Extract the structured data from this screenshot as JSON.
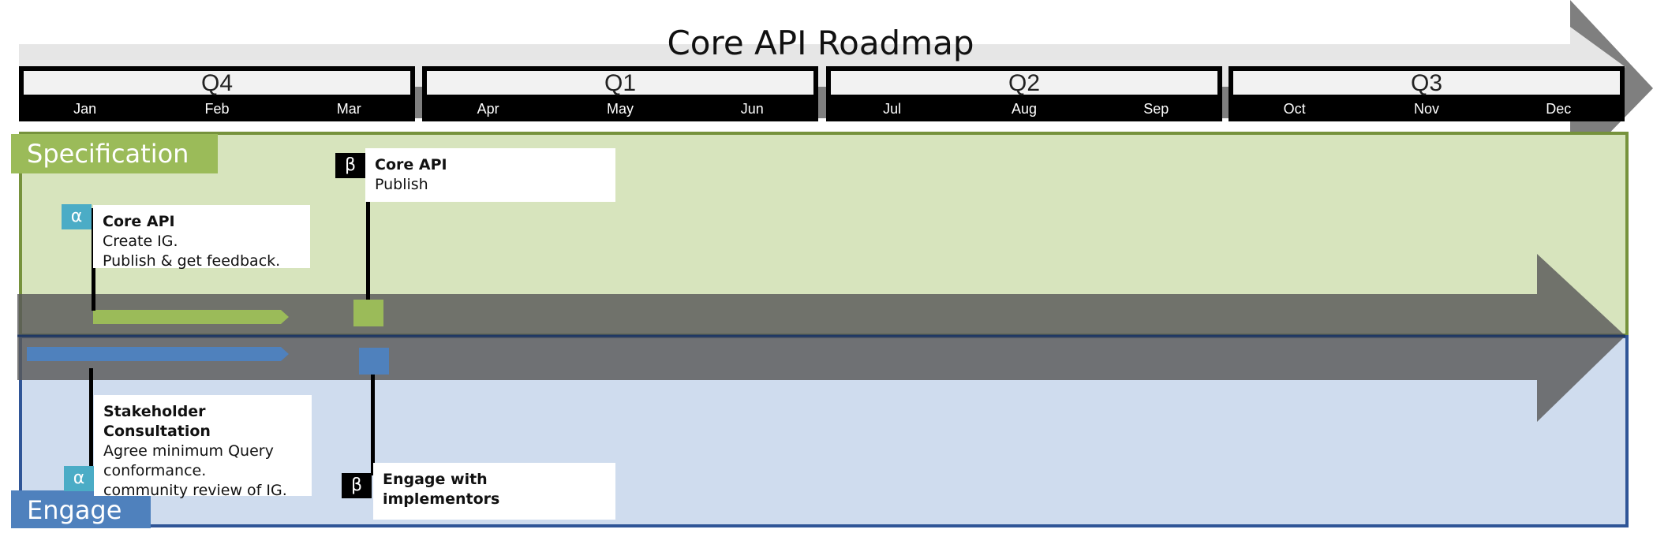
{
  "title": "Core API Roadmap",
  "quarters": [
    {
      "label": "Q4",
      "months": [
        "Jan",
        "Feb",
        "Mar"
      ]
    },
    {
      "label": "Q1",
      "months": [
        "Apr",
        "May",
        "Jun"
      ]
    },
    {
      "label": "Q2",
      "months": [
        "Jul",
        "Aug",
        "Sep"
      ]
    },
    {
      "label": "Q3",
      "months": [
        "Oct",
        "Nov",
        "Dec"
      ]
    }
  ],
  "lanes": {
    "specification": {
      "label": "Specification",
      "color": "#9bbb59",
      "bg": "#d7e4bd"
    },
    "engage": {
      "label": "Engage",
      "color": "#4f81bd",
      "bg": "#cfdcee"
    }
  },
  "milestones": {
    "spec_alpha": {
      "badge": "α",
      "title": "Core API",
      "lines": [
        "Create IG.",
        "Publish & get feedback."
      ]
    },
    "spec_beta": {
      "badge": "β",
      "title": "Core API",
      "lines": [
        "Publish"
      ]
    },
    "engage_alpha": {
      "badge": "α",
      "title": "Stakeholder Consultation",
      "lines": [
        "Agree minimum Query",
        "conformance.",
        "community review of IG."
      ]
    },
    "engage_beta": {
      "badge": "β",
      "title": "Engage with implementors",
      "lines": []
    }
  },
  "colors": {
    "spec_bar": "#9bbb59",
    "engage_bar": "#4f81bd",
    "alpha_badge": "#4bacc6",
    "beta_badge": "#000000",
    "center_arrow": "#595959"
  }
}
